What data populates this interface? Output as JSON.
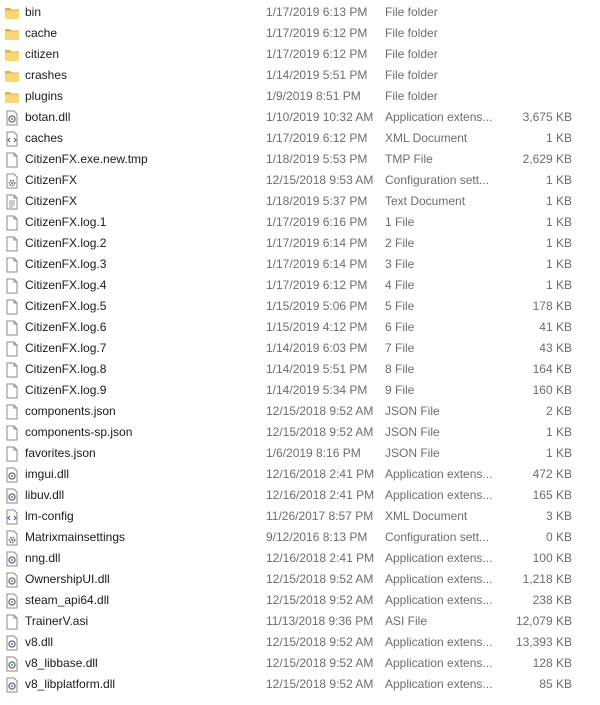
{
  "files": [
    {
      "name": "bin",
      "date": "1/17/2019 6:13 PM",
      "type": "File folder",
      "size": "",
      "icon": "folder-icon"
    },
    {
      "name": "cache",
      "date": "1/17/2019 6:12 PM",
      "type": "File folder",
      "size": "",
      "icon": "folder-icon"
    },
    {
      "name": "citizen",
      "date": "1/17/2019 6:12 PM",
      "type": "File folder",
      "size": "",
      "icon": "folder-icon"
    },
    {
      "name": "crashes",
      "date": "1/14/2019 5:51 PM",
      "type": "File folder",
      "size": "",
      "icon": "folder-icon"
    },
    {
      "name": "plugins",
      "date": "1/9/2019 8:51 PM",
      "type": "File folder",
      "size": "",
      "icon": "folder-icon"
    },
    {
      "name": "botan.dll",
      "date": "1/10/2019 10:32 AM",
      "type": "Application extens...",
      "size": "3,675 KB",
      "icon": "dll-icon"
    },
    {
      "name": "caches",
      "date": "1/17/2019 6:12 PM",
      "type": "XML Document",
      "size": "1 KB",
      "icon": "xml-icon"
    },
    {
      "name": "CitizenFX.exe.new.tmp",
      "date": "1/18/2019 5:53 PM",
      "type": "TMP File",
      "size": "2,629 KB",
      "icon": "file-icon"
    },
    {
      "name": "CitizenFX",
      "date": "12/15/2018 9:53 AM",
      "type": "Configuration sett...",
      "size": "1 KB",
      "icon": "config-icon"
    },
    {
      "name": "CitizenFX",
      "date": "1/18/2019 5:37 PM",
      "type": "Text Document",
      "size": "1 KB",
      "icon": "text-icon"
    },
    {
      "name": "CitizenFX.log.1",
      "date": "1/17/2019 6:16 PM",
      "type": "1 File",
      "size": "1 KB",
      "icon": "file-icon"
    },
    {
      "name": "CitizenFX.log.2",
      "date": "1/17/2019 6:14 PM",
      "type": "2 File",
      "size": "1 KB",
      "icon": "file-icon"
    },
    {
      "name": "CitizenFX.log.3",
      "date": "1/17/2019 6:14 PM",
      "type": "3 File",
      "size": "1 KB",
      "icon": "file-icon"
    },
    {
      "name": "CitizenFX.log.4",
      "date": "1/17/2019 6:12 PM",
      "type": "4 File",
      "size": "1 KB",
      "icon": "file-icon"
    },
    {
      "name": "CitizenFX.log.5",
      "date": "1/15/2019 5:06 PM",
      "type": "5 File",
      "size": "178 KB",
      "icon": "file-icon"
    },
    {
      "name": "CitizenFX.log.6",
      "date": "1/15/2019 4:12 PM",
      "type": "6 File",
      "size": "41 KB",
      "icon": "file-icon"
    },
    {
      "name": "CitizenFX.log.7",
      "date": "1/14/2019 6:03 PM",
      "type": "7 File",
      "size": "43 KB",
      "icon": "file-icon"
    },
    {
      "name": "CitizenFX.log.8",
      "date": "1/14/2019 5:51 PM",
      "type": "8 File",
      "size": "164 KB",
      "icon": "file-icon"
    },
    {
      "name": "CitizenFX.log.9",
      "date": "1/14/2019 5:34 PM",
      "type": "9 File",
      "size": "160 KB",
      "icon": "file-icon"
    },
    {
      "name": "components.json",
      "date": "12/15/2018 9:52 AM",
      "type": "JSON File",
      "size": "2 KB",
      "icon": "file-icon"
    },
    {
      "name": "components-sp.json",
      "date": "12/15/2018 9:52 AM",
      "type": "JSON File",
      "size": "1 KB",
      "icon": "file-icon"
    },
    {
      "name": "favorites.json",
      "date": "1/6/2019 8:16 PM",
      "type": "JSON File",
      "size": "1 KB",
      "icon": "file-icon"
    },
    {
      "name": "imgui.dll",
      "date": "12/16/2018 2:41 PM",
      "type": "Application extens...",
      "size": "472 KB",
      "icon": "dll-icon"
    },
    {
      "name": "libuv.dll",
      "date": "12/16/2018 2:41 PM",
      "type": "Application extens...",
      "size": "165 KB",
      "icon": "dll-icon"
    },
    {
      "name": "lm-config",
      "date": "11/26/2017 8:57 PM",
      "type": "XML Document",
      "size": "3 KB",
      "icon": "xml-icon"
    },
    {
      "name": "Matrixmainsettings",
      "date": "9/12/2016 8:13 PM",
      "type": "Configuration sett...",
      "size": "0 KB",
      "icon": "config-icon"
    },
    {
      "name": "nng.dll",
      "date": "12/16/2018 2:41 PM",
      "type": "Application extens...",
      "size": "100 KB",
      "icon": "dll-icon"
    },
    {
      "name": "OwnershipUI.dll",
      "date": "12/15/2018 9:52 AM",
      "type": "Application extens...",
      "size": "1,218 KB",
      "icon": "dll-icon"
    },
    {
      "name": "steam_api64.dll",
      "date": "12/15/2018 9:52 AM",
      "type": "Application extens...",
      "size": "238 KB",
      "icon": "dll-icon"
    },
    {
      "name": "TrainerV.asi",
      "date": "11/13/2018 9:36 PM",
      "type": "ASI File",
      "size": "12,079 KB",
      "icon": "file-icon"
    },
    {
      "name": "v8.dll",
      "date": "12/15/2018 9:52 AM",
      "type": "Application extens...",
      "size": "13,393 KB",
      "icon": "dll-icon"
    },
    {
      "name": "v8_libbase.dll",
      "date": "12/15/2018 9:52 AM",
      "type": "Application extens...",
      "size": "128 KB",
      "icon": "dll-icon"
    },
    {
      "name": "v8_libplatform.dll",
      "date": "12/15/2018 9:52 AM",
      "type": "Application extens...",
      "size": "85 KB",
      "icon": "dll-icon"
    }
  ]
}
